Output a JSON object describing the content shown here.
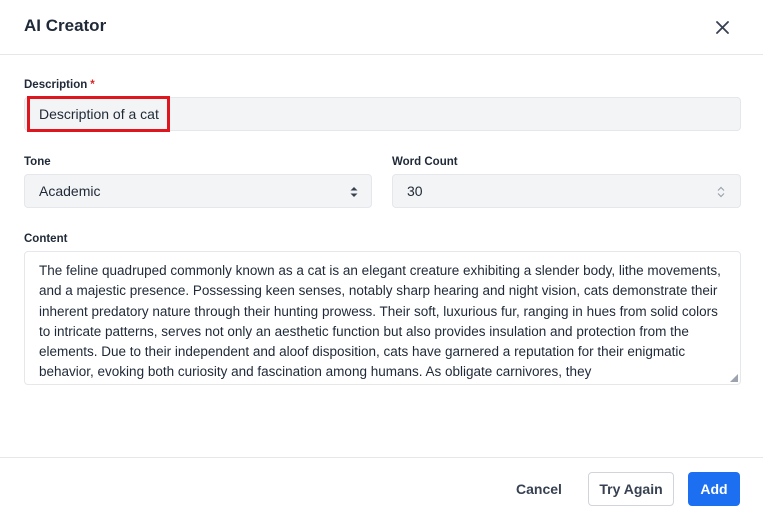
{
  "modal": {
    "title": "AI Creator"
  },
  "description": {
    "label": "Description",
    "required_mark": "*",
    "value": "Description of a cat"
  },
  "tone": {
    "label": "Tone",
    "selected": "Academic"
  },
  "word_count": {
    "label": "Word Count",
    "value": "30"
  },
  "content": {
    "label": "Content",
    "text": "The feline quadruped commonly known as a cat is an elegant creature exhibiting a slender body, lithe movements, and a majestic presence. Possessing keen senses, notably sharp hearing and night vision, cats demonstrate their inherent predatory nature through their hunting prowess. Their soft, luxurious fur, ranging in hues from solid colors to intricate patterns, serves not only an aesthetic function but also provides insulation and protection from the elements. Due to their independent and aloof disposition, cats have garnered a reputation for their enigmatic behavior, evoking both curiosity and fascination among humans. As obligate carnivores, they"
  },
  "footer": {
    "cancel_label": "Cancel",
    "try_again_label": "Try Again",
    "add_label": "Add"
  },
  "colors": {
    "primary": "#1d6ff2",
    "highlight": "#e0161f",
    "required": "#dc2626"
  },
  "icons": {
    "close": "close-icon",
    "select_arrows": "chevron-up-down-icon",
    "spinner": "number-spinner-icon",
    "resize": "resize-grip-icon"
  }
}
